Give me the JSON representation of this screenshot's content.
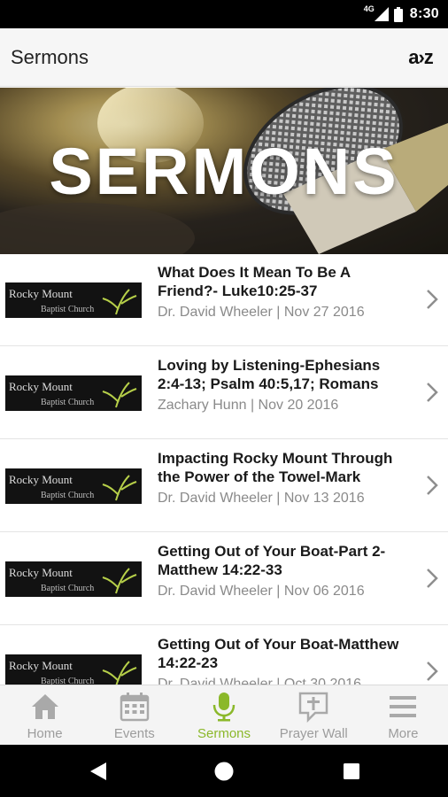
{
  "status_bar": {
    "network": "4G",
    "time": "8:30",
    "icons": [
      "signal-icon",
      "battery-icon"
    ]
  },
  "app_bar": {
    "title": "Sermons",
    "sort_label": "a›z"
  },
  "banner": {
    "title": "SERMONS"
  },
  "thumbnail": {
    "line1": "Rocky Mount",
    "line2": "Baptist Church"
  },
  "sermons": [
    {
      "title": "What Does It Mean To Be A Friend?- Luke10:25-37",
      "meta": "Dr. David Wheeler | Nov 27 2016"
    },
    {
      "title": "Loving by Listening-Ephesians 2:4-13; Psalm 40:5,17; Romans",
      "meta": "Zachary Hunn | Nov 20 2016"
    },
    {
      "title": "Impacting Rocky Mount Through the Power of the Towel-Mark",
      "meta": "Dr. David Wheeler | Nov 13 2016"
    },
    {
      "title": "Getting Out of Your Boat-Part 2-Matthew 14:22-33",
      "meta": "Dr. David Wheeler | Nov 06 2016"
    },
    {
      "title": "Getting Out of Your Boat-Matthew 14:22-23",
      "meta": "Dr. David Wheeler | Oct 30 2016"
    }
  ],
  "tabs": [
    {
      "label": "Home",
      "icon": "home-icon",
      "active": false
    },
    {
      "label": "Events",
      "icon": "calendar-icon",
      "active": false
    },
    {
      "label": "Sermons",
      "icon": "microphone-icon",
      "active": true
    },
    {
      "label": "Prayer Wall",
      "icon": "prayer-wall-icon",
      "active": false
    },
    {
      "label": "More",
      "icon": "menu-icon",
      "active": false
    }
  ],
  "nav": {
    "icons": [
      "back-icon",
      "home-circle-icon",
      "recents-icon"
    ]
  },
  "colors": {
    "accent": "#8bb82a",
    "inactive": "#9c9c9c",
    "app_bar": "#f6f6f6",
    "status_bar": "#000000"
  }
}
